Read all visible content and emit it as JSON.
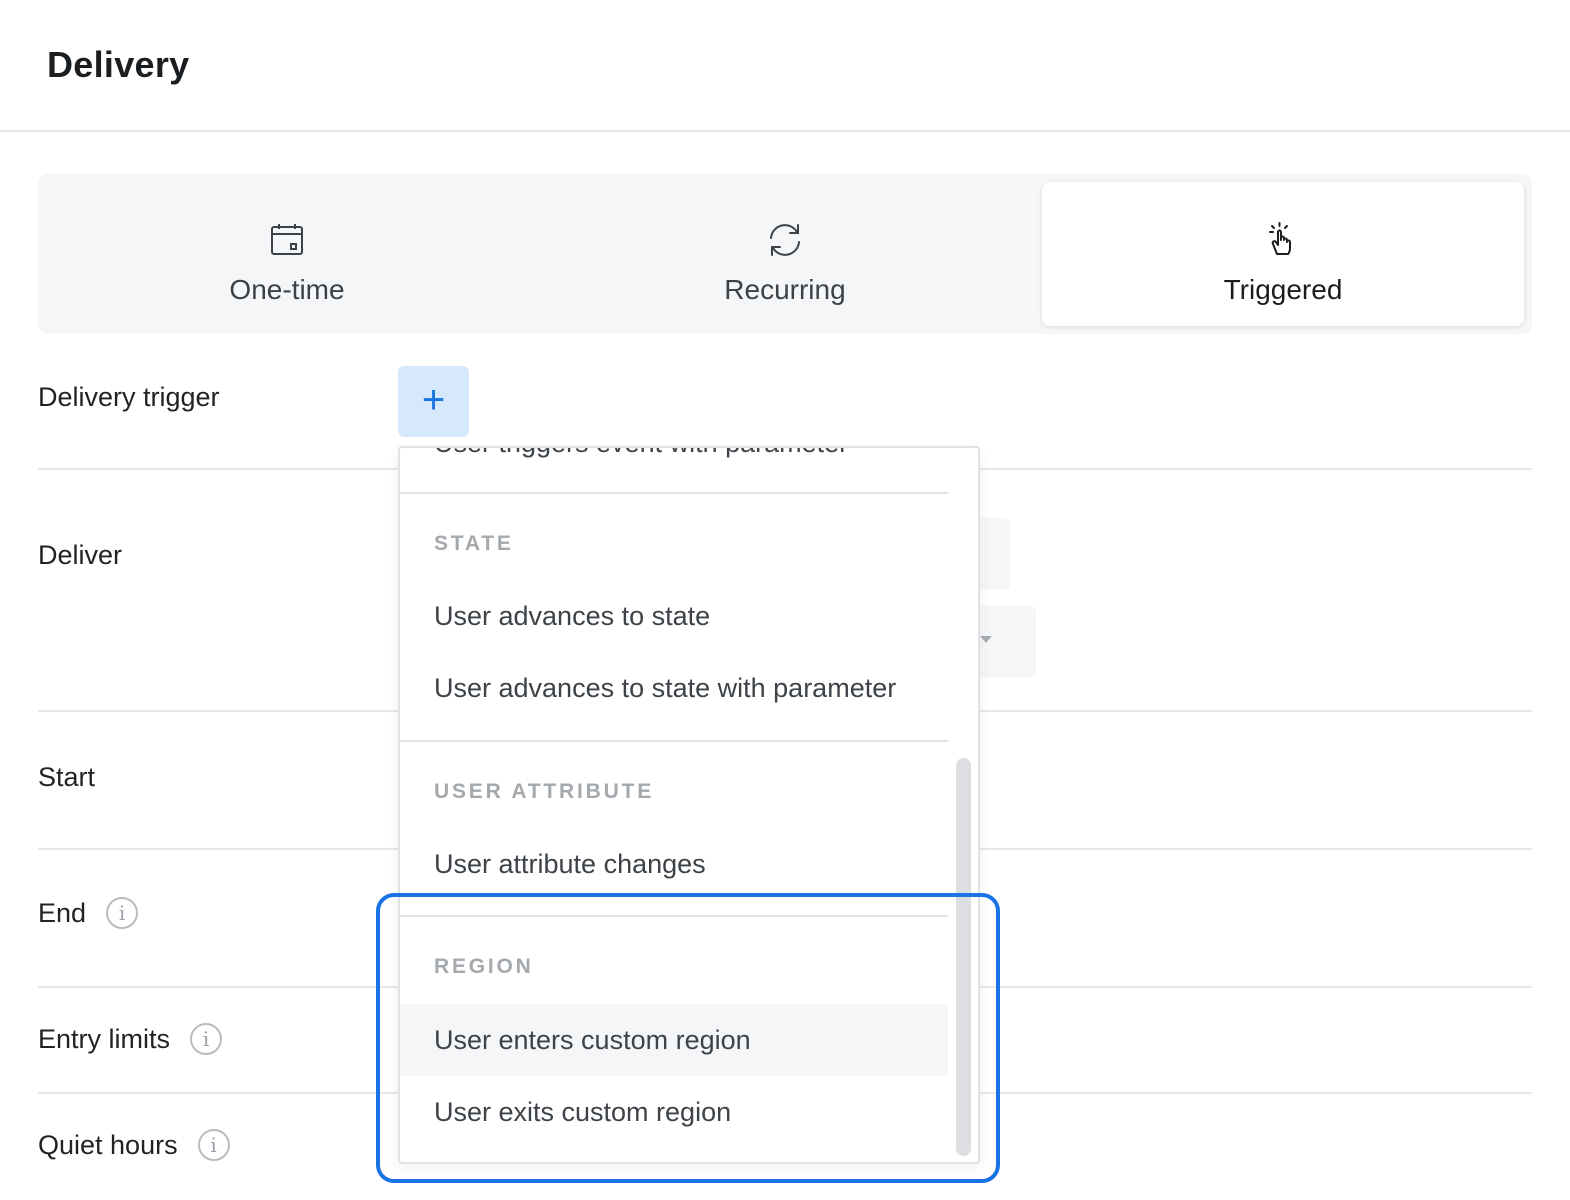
{
  "header": {
    "title": "Delivery"
  },
  "tabs": [
    {
      "label": "One-time",
      "icon": "calendar-icon"
    },
    {
      "label": "Recurring",
      "icon": "refresh-icon"
    },
    {
      "label": "Triggered",
      "icon": "pointer-hand-icon",
      "active": true
    }
  ],
  "rows": {
    "delivery_trigger": "Delivery trigger",
    "deliver": "Deliver",
    "start": "Start",
    "end": "End",
    "entry_limits": "Entry limits",
    "quiet_hours": "Quiet hours"
  },
  "add_button": {
    "label": "+"
  },
  "dropdown": {
    "cut_item": "User triggers event with parameter",
    "sections": [
      {
        "heading": "STATE",
        "items": [
          "User advances to state",
          "User advances to state with parameter"
        ]
      },
      {
        "heading": "USER ATTRIBUTE",
        "items": [
          "User attribute changes"
        ]
      },
      {
        "heading": "REGION",
        "items": [
          "User enters custom region",
          "User exits custom region"
        ]
      }
    ]
  },
  "colors": {
    "accent": "#1b74e4",
    "accent_light": "#d6e8fb",
    "panel": "#f5f6f8"
  }
}
